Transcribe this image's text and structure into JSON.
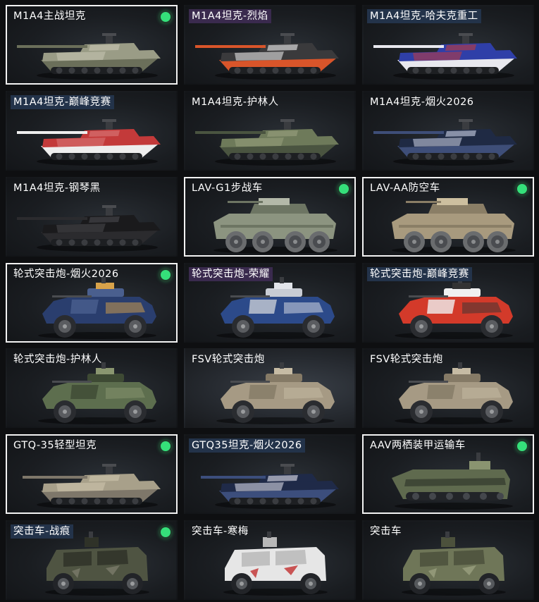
{
  "colors": {
    "selected_border": "#f2f2f2",
    "status_dot": "#35e07a",
    "label_purple": "#3a2a4e",
    "label_blue": "#23334a"
  },
  "cards": [
    {
      "label": "M1A4主战坦克",
      "tag": "n",
      "selected": true,
      "status": true,
      "kind": "tank",
      "c1": "#9a9c86",
      "c2": "#6b6f5a",
      "c3": "#c9c7b4"
    },
    {
      "label": "M1A4坦克-烈焰",
      "tag": "p",
      "selected": false,
      "status": false,
      "kind": "tank",
      "c1": "#3a3a3c",
      "c2": "#d9552a",
      "c3": "#f2f2f2"
    },
    {
      "label": "M1A4坦克-哈夫克重工",
      "tag": "b",
      "selected": false,
      "status": false,
      "kind": "tank",
      "c1": "#2f3fa8",
      "c2": "#e8e8ee",
      "c3": "#c23a3a"
    },
    {
      "label": "M1A4坦克-巅峰竞赛",
      "tag": "b",
      "selected": false,
      "status": false,
      "kind": "tank",
      "c1": "#c33a3a",
      "c2": "#eeeeee",
      "c3": "#d97a7a"
    },
    {
      "label": "M1A4坦克-护林人",
      "tag": "n",
      "selected": false,
      "status": false,
      "kind": "tank",
      "c1": "#6e7a5a",
      "c2": "#4a5440",
      "c3": "#99a07e"
    },
    {
      "label": "M1A4坦克-烟火2026",
      "tag": "n",
      "selected": false,
      "status": false,
      "kind": "tank",
      "c1": "#1f2a44",
      "c2": "#3e4e78",
      "c3": "#cfd6ea"
    },
    {
      "label": "M1A4坦克-钢琴黑",
      "tag": "n",
      "selected": false,
      "status": false,
      "kind": "tank",
      "c1": "#1a1a1c",
      "c2": "#2b2b2e",
      "c3": "#4a4a4e"
    },
    {
      "label": "LAV-G1步战车",
      "tag": "n",
      "selected": true,
      "status": true,
      "kind": "lav",
      "c1": "#8c9480",
      "c2": "#6d7563",
      "c3": "#b3b8a8"
    },
    {
      "label": "LAV-AA防空车",
      "tag": "n",
      "selected": true,
      "status": true,
      "kind": "lav",
      "c1": "#a89a7e",
      "c2": "#8a7e66",
      "c3": "#cdbf9f"
    },
    {
      "label": "轮式突击炮-烟火2026",
      "tag": "n",
      "selected": true,
      "status": true,
      "kind": "apc",
      "c1": "#2a3e6e",
      "c2": "#4a5f8e",
      "c3": "#d8a24a"
    },
    {
      "label": "轮式突击炮-荣耀",
      "tag": "p",
      "selected": false,
      "status": false,
      "kind": "apc",
      "c1": "#2c4a8a",
      "c2": "#c8ccd4",
      "c3": "#e2e4ea"
    },
    {
      "label": "轮式突击炮-巅峰竞赛",
      "tag": "b",
      "selected": false,
      "status": false,
      "kind": "apc",
      "c1": "#d33a2a",
      "c2": "#f0f0f0",
      "c3": "#333333"
    },
    {
      "label": "轮式突击炮-护林人",
      "tag": "n",
      "selected": false,
      "status": false,
      "kind": "apc",
      "c1": "#5d6e4e",
      "c2": "#3e4a34",
      "c3": "#8a9670"
    },
    {
      "label": "FSV轮式突击炮",
      "tag": "n",
      "selected": false,
      "status": false,
      "kind": "apc",
      "c1": "#a69a84",
      "c2": "#857a66",
      "c3": "#c6bba4",
      "bright": true
    },
    {
      "label": "FSV轮式突击炮",
      "tag": "n",
      "selected": false,
      "status": false,
      "kind": "apc",
      "c1": "#a69a84",
      "c2": "#857a66",
      "c3": "#c6bba4"
    },
    {
      "label": "GTQ-35轻型坦克",
      "tag": "n",
      "selected": true,
      "status": true,
      "kind": "light",
      "c1": "#a8a08a",
      "c2": "#7e776a",
      "c3": "#cfc6ae"
    },
    {
      "label": "GTQ35坦克-烟火2026",
      "tag": "b",
      "selected": false,
      "status": false,
      "kind": "light",
      "c1": "#1f2a48",
      "c2": "#3c4e7c",
      "c3": "#e6e6f0"
    },
    {
      "label": "AAV两栖装甲运输车",
      "tag": "n",
      "selected": true,
      "status": true,
      "kind": "aav",
      "c1": "#5f6a4e",
      "c2": "#3f4736",
      "c3": "#8a9470"
    },
    {
      "label": "突击车-战痕",
      "tag": "b",
      "selected": false,
      "status": true,
      "kind": "truck",
      "c1": "#4f5442",
      "c2": "#2f3228",
      "c3": "#7a7a6a"
    },
    {
      "label": "突击车-寒梅",
      "tag": "n",
      "selected": false,
      "status": false,
      "kind": "truck",
      "c1": "#e6e6e6",
      "c2": "#b8b8b8",
      "c3": "#c23030"
    },
    {
      "label": "突击车",
      "tag": "n",
      "selected": false,
      "status": false,
      "kind": "truck",
      "c1": "#6f7658",
      "c2": "#4c513c",
      "c3": "#9aa080"
    }
  ]
}
